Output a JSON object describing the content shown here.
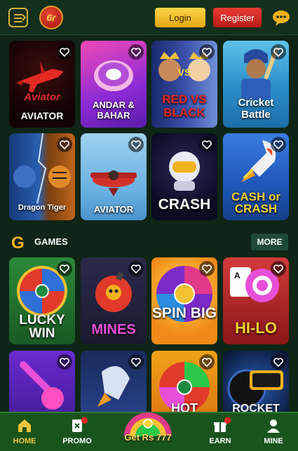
{
  "header": {
    "logo_text": "6r",
    "login_label": "Login",
    "register_label": "Register"
  },
  "colors": {
    "background": "#0f2516",
    "header": "#13301c",
    "accent_gold": "#f3b21d",
    "login": "#f5c230",
    "register": "#d9271f",
    "bottom_nav": "#19541d"
  },
  "grid_top": [
    {
      "name": "aviator",
      "title": "AVIATOR"
    },
    {
      "name": "andar-bahar",
      "title": "ANDAR & BAHAR"
    },
    {
      "name": "red-vs-black",
      "title": "RED VS BLACK"
    },
    {
      "name": "cricket-battle",
      "title": "Cricket Battle"
    },
    {
      "name": "dragon-tiger",
      "title": "Dragon Tiger"
    },
    {
      "name": "aviator-2",
      "title": "AVIATOR"
    },
    {
      "name": "crash",
      "title": "CRASH"
    },
    {
      "name": "cash-or-crash",
      "title": "CASH or CRASH"
    }
  ],
  "games_section": {
    "title": "GAMES",
    "more_label": "MORE",
    "icon": "g-logo-icon"
  },
  "grid_games": [
    {
      "name": "lucky-win",
      "title": "LUCKY WIN"
    },
    {
      "name": "mines",
      "title": "MINES"
    },
    {
      "name": "spin-big",
      "title": "SPIN BIG"
    },
    {
      "name": "hi-lo",
      "title": "HI-LO"
    },
    {
      "name": "ball-game",
      "title": ""
    },
    {
      "name": "rocket-game",
      "title": ""
    },
    {
      "name": "hot-wheel",
      "title": "HOT"
    },
    {
      "name": "rocket-deposit",
      "title": "ROCKET"
    }
  ],
  "bottom_nav": {
    "home": "HOME",
    "promo": "PROMO",
    "center": "Get Rs 777",
    "earn": "EARN",
    "mine": "MINE"
  }
}
